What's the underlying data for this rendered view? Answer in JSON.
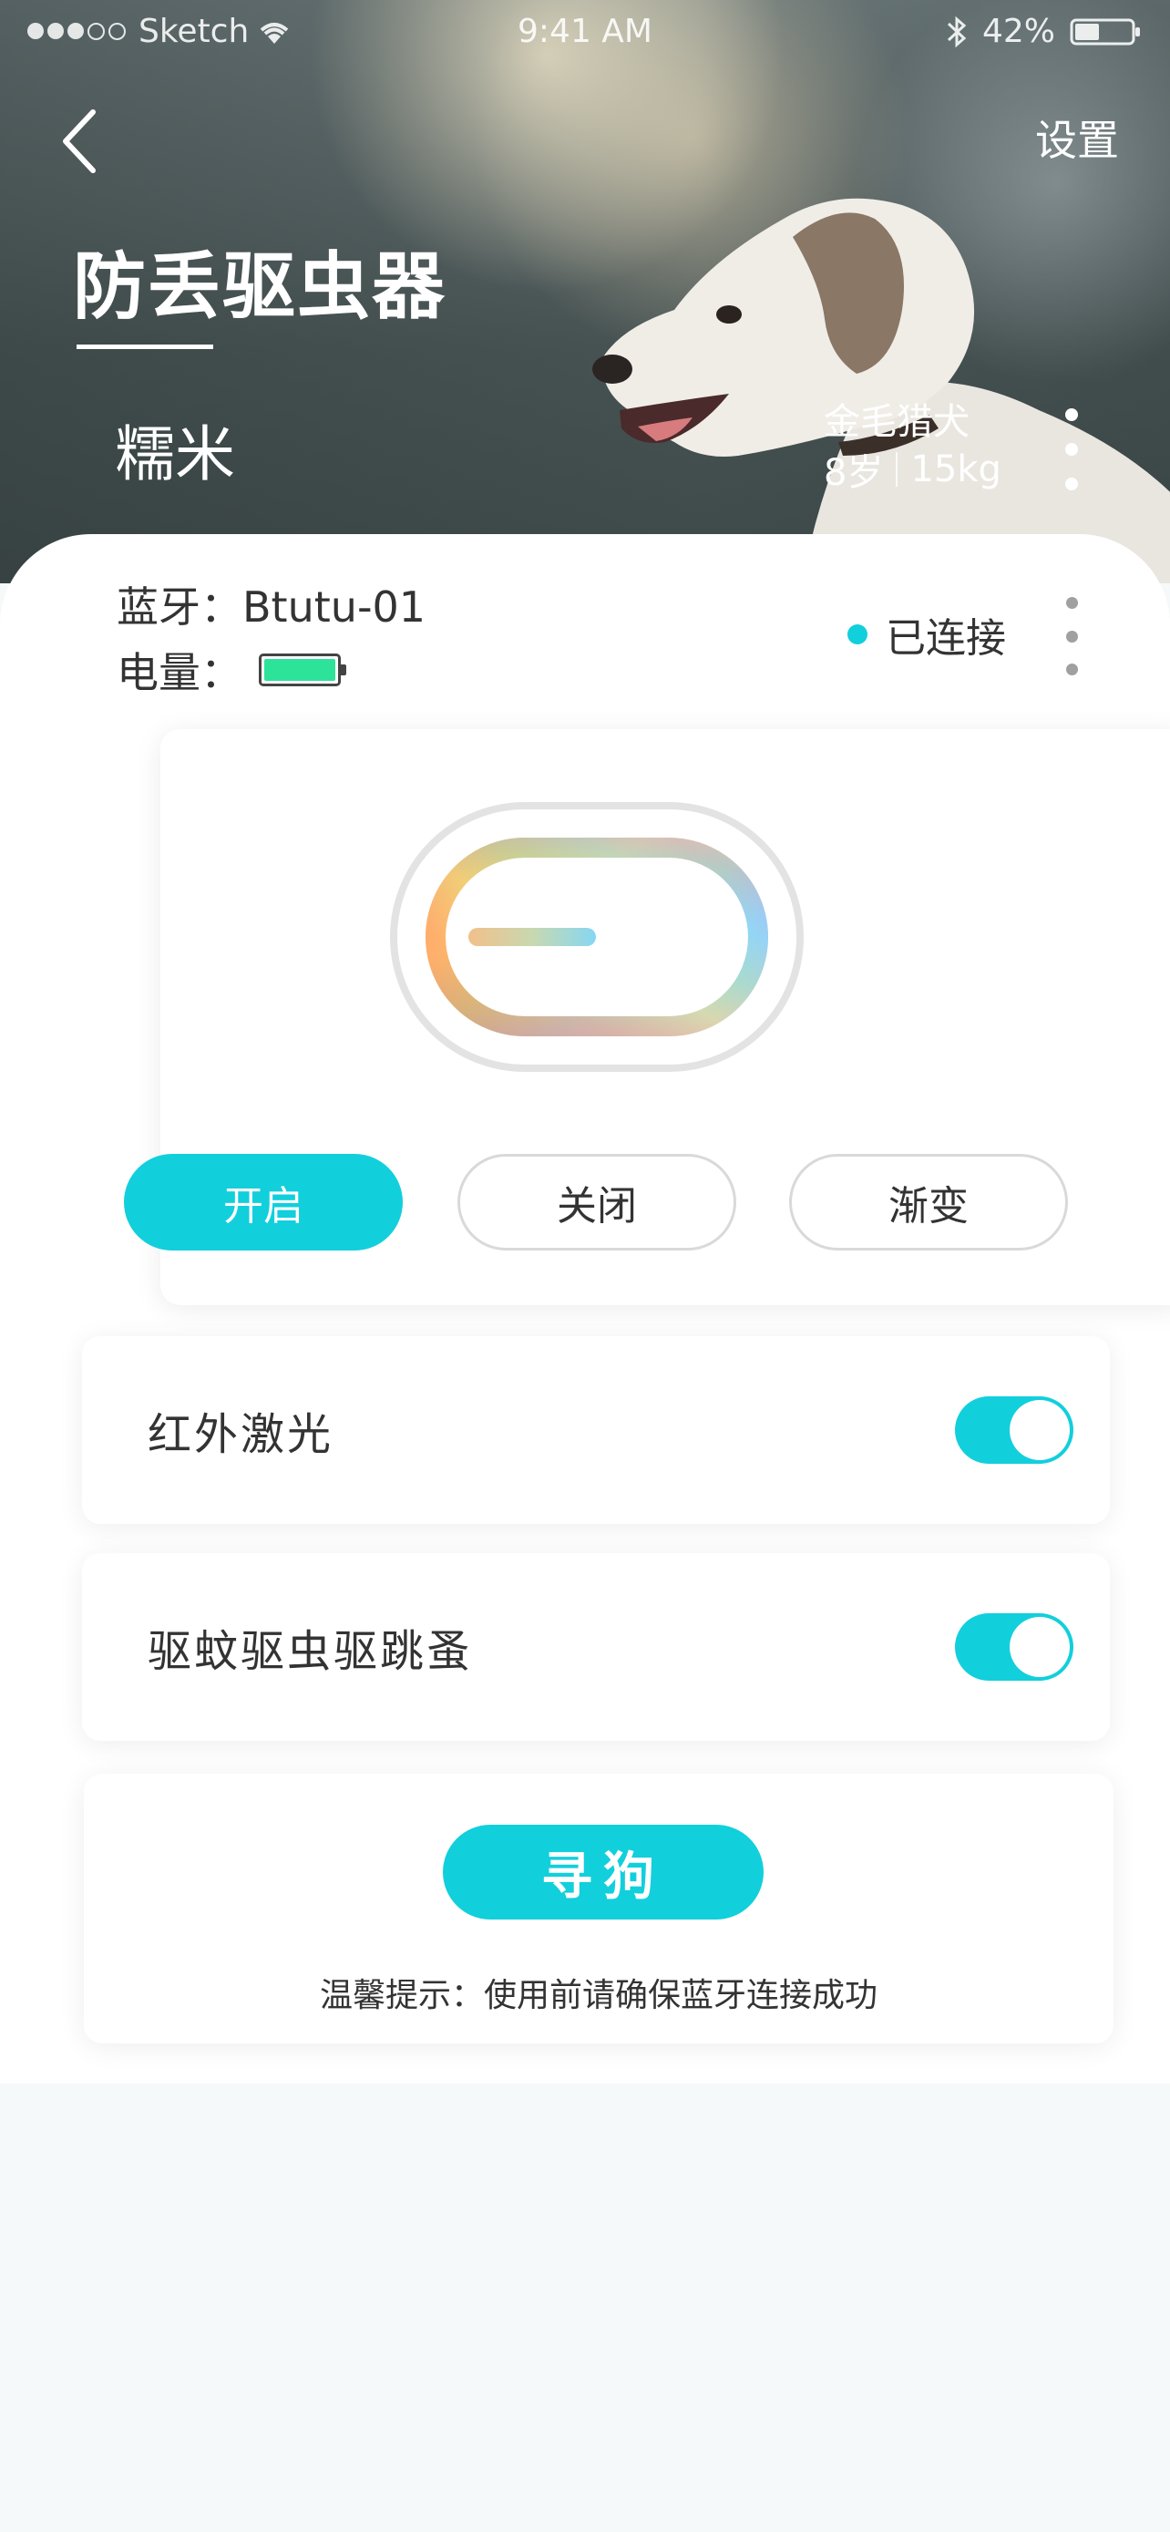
{
  "status_bar": {
    "carrier": "Sketch",
    "time": "9:41 AM",
    "battery": "42%"
  },
  "header": {
    "settings_label": "设置",
    "title": "防丢驱虫器",
    "pet_name": "糯米",
    "breed": "金毛猎犬",
    "age": "8岁",
    "weight": "15kg"
  },
  "device_info": {
    "bluetooth_label": "蓝牙：",
    "bluetooth_name": "Btutu-01",
    "battery_label": "电量：",
    "battery_level": 1.0,
    "connection_status": "已连接",
    "accent_color": "#12cfdc",
    "battery_color": "#2de39a"
  },
  "light_modes": [
    {
      "label": "开启",
      "selected": true
    },
    {
      "label": "关闭",
      "selected": false
    },
    {
      "label": "渐变",
      "selected": false
    }
  ],
  "features": [
    {
      "label": "红外激光",
      "enabled": true
    },
    {
      "label": "驱蚊驱虫驱跳蚤",
      "enabled": true
    }
  ],
  "find": {
    "button_label": "寻狗",
    "tip": "温馨提示：使用前请确保蓝牙连接成功"
  }
}
